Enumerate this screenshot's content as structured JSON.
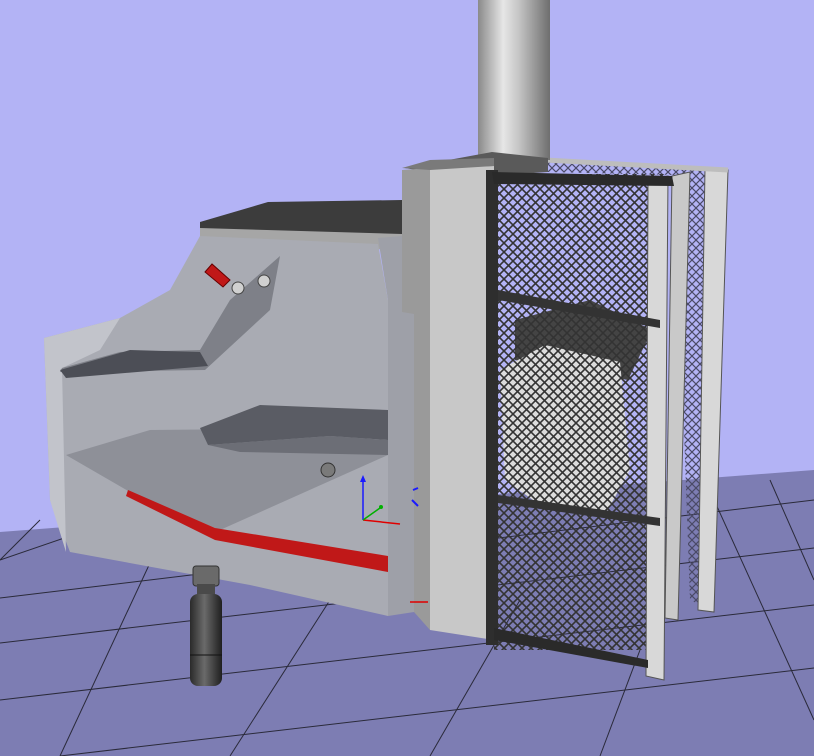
{
  "viewport": {
    "background_color": "#b3b3f5",
    "floor_color": "#7d7db3",
    "grid_line_color": "#2a2a3a"
  },
  "scene": {
    "objects": [
      "chimney-pipe",
      "hopper-housing",
      "center-column",
      "mesh-cage",
      "gas-cylinder",
      "axis-gizmo"
    ],
    "accent_color": "#c01818",
    "mesh_color": "#3a3a3a"
  }
}
